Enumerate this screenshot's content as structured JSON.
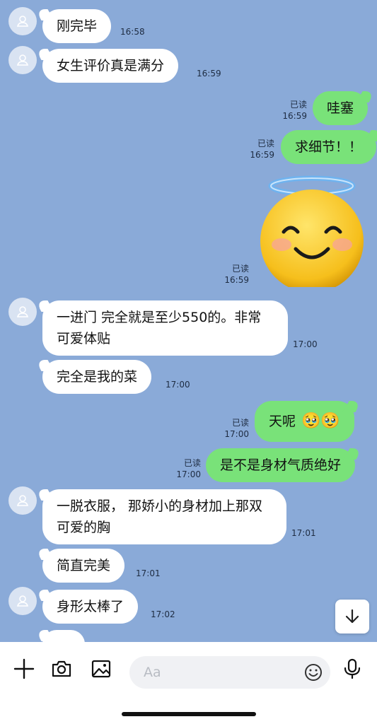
{
  "messages": [
    {
      "text": "刚完毕",
      "time": "16:58"
    },
    {
      "text": "女生评价真是满分",
      "time": "16:59"
    },
    {
      "text": "哇塞",
      "time": "16:59",
      "read": "已读"
    },
    {
      "text": "求细节！！",
      "time": "16:59",
      "read": "已读"
    },
    {
      "sticker": "halo-smiling-face",
      "time": "16:59",
      "read": "已读"
    },
    {
      "text": "一进门 完全就是至少550的。非常可爱体贴",
      "time": "17:00"
    },
    {
      "text": "完全是我的菜",
      "time": "17:00"
    },
    {
      "text": "天呢",
      "emoji": "🥹🥹",
      "time": "17:00",
      "read": "已读"
    },
    {
      "text": "是不是身材气质绝好",
      "time": "17:00",
      "read": "已读"
    },
    {
      "text": "一脱衣服， 那娇小的身材加上那双可爱的胸",
      "time": "17:01"
    },
    {
      "text": "简直完美",
      "time": "17:01"
    },
    {
      "text": "身形太棒了",
      "time": "17:02"
    },
    {
      "text": "",
      "time": ""
    }
  ],
  "composer": {
    "placeholder": "Aa",
    "tools": [
      "plus-icon",
      "camera-icon",
      "image-icon",
      "emoji-icon",
      "mic-icon"
    ]
  },
  "colors": {
    "background": "#8aaad8",
    "my_bubble": "#79e279",
    "their_bubble": "#ffffff"
  }
}
